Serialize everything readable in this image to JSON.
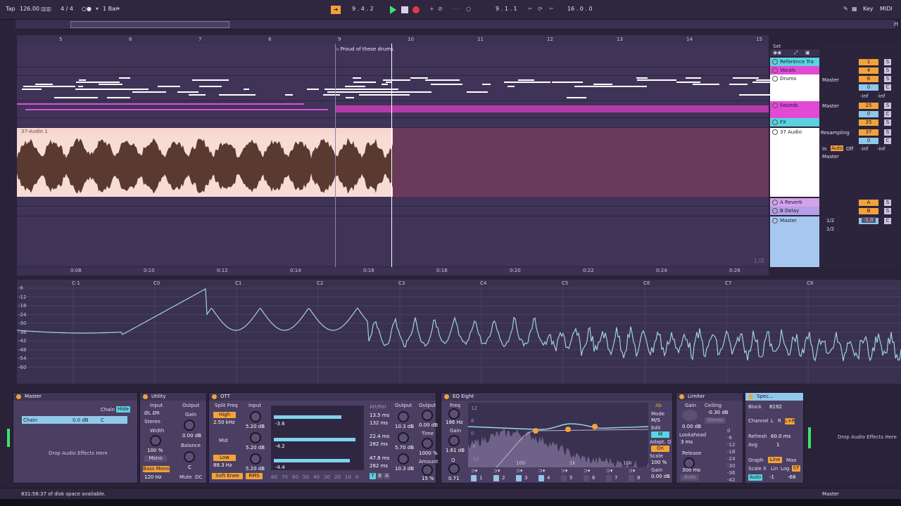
{
  "transport": {
    "tap": "Tap",
    "tempo": "126.00",
    "signature": "4 / 4",
    "metro_dots": "○●",
    "quantize": "1 Bar",
    "position": "9 .  4 .  2",
    "loop_start": "9 .  1 .  1",
    "loop_length": "16 .  0 .  0",
    "key_label": "Key",
    "midi_label": "MIDI",
    "follow_label": "H"
  },
  "ruler": {
    "bars": [
      "5",
      "6",
      "7",
      "8",
      "9",
      "10",
      "11",
      "12",
      "13",
      "14",
      "15"
    ],
    "times": [
      "0:08",
      "0:10",
      "0:12",
      "0:14",
      "0:16",
      "0:18",
      "0:20",
      "0:22",
      "0:24",
      "0:26"
    ],
    "zoom": "1/8"
  },
  "locator": "Proud of these drums",
  "audio_clip": {
    "title": "37-Audio 1"
  },
  "tracks": {
    "set_label": "Set",
    "items": [
      {
        "name": "Reference Tra",
        "color": "#5ad3e0"
      },
      {
        "name": "Vocals",
        "color": "#e24ad6"
      },
      {
        "name": "Drums",
        "color": "#ffffff"
      },
      {
        "name": "Sounds",
        "color": "#e24ad6"
      },
      {
        "name": "FX",
        "color": "#5ad3e0"
      },
      {
        "name": "37 Audio",
        "color": "#ffffff"
      },
      {
        "name": "A Reverb",
        "color": "#d5a3ea"
      },
      {
        "name": "B Delay",
        "color": "#b49fe8"
      },
      {
        "name": "Master",
        "color": "#a6c8f0"
      }
    ]
  },
  "mixer": {
    "route_drums": "Master",
    "route_sounds": "Master",
    "route_audio": "Resampling",
    "route_audio_out": "Master",
    "nums": [
      "1",
      "4",
      "6",
      "0",
      "25",
      "0",
      "35",
      "37",
      "0",
      "A",
      "B",
      "0"
    ],
    "inf": "-inf",
    "in_auto_off": [
      "In",
      "Auto",
      "Off"
    ],
    "sends": [
      "1/2",
      "1/2"
    ],
    "master_vol": "-1.0",
    "s_label": "S",
    "c_label": "C"
  },
  "spectrum": {
    "db": [
      "-6",
      "-12",
      "-18",
      "-24",
      "-30",
      "-36",
      "-42",
      "-48",
      "-54",
      "-60"
    ],
    "notes": [
      "C-1",
      "C0",
      "C1",
      "C2",
      "C3",
      "C4",
      "C5",
      "C6",
      "C7",
      "C8"
    ]
  },
  "devices": {
    "master": {
      "title": "Master",
      "chain_label": "Chain",
      "hide_label": "Hide",
      "chain_name": "Chain",
      "chain_db": "0.0 dB",
      "chain_pan": "C",
      "drop": "Drop Audio Effects Here"
    },
    "utility": {
      "title": "Utility",
      "input": "Input",
      "output": "Output",
      "phase": "ØL  ØR",
      "stereo": "Stereo",
      "gain_label": "Gain",
      "gain": "0.00 dB",
      "width_label": "Width",
      "width": "100 %",
      "balance_label": "Balance",
      "balance": "C",
      "mono": "Mono",
      "bass_mono": "Bass Mono",
      "bass_freq": "120 Hz",
      "mute": "Mute",
      "dc": "DC"
    },
    "ott": {
      "title": "OTT",
      "split_freq": "Split Freq",
      "input": "Input",
      "high": "High",
      "high_freq": "2.50 kHz",
      "mid": "Mid",
      "low": "Low",
      "low_freq": "88.3 Hz",
      "input_vals": [
        "5.20 dB",
        "5.20 dB",
        "5.20 dB"
      ],
      "bar_vals": [
        "-3.6",
        "-4.2",
        "-4.4"
      ],
      "att_rel": "Att/Rel",
      "times": [
        "13.5 ms",
        "132 ms",
        "22.4 ms",
        "282 ms",
        "47.8 ms",
        "282 ms"
      ],
      "output": "Output",
      "output_vals": [
        "10.3 dB",
        "5.70 dB",
        "10.3 dB"
      ],
      "out2": "Output",
      "out2_val": "0.00 dB",
      "time_label": "Time",
      "time_val": "1000 %",
      "amount_label": "Amount",
      "amount_val": "15 %",
      "soft_knee": "Soft Knee",
      "rms": "RMS",
      "scale": [
        "80",
        "70",
        "60",
        "50",
        "40",
        "30",
        "20",
        "10",
        "0"
      ],
      "tba": [
        "T",
        "B",
        "A"
      ]
    },
    "eq": {
      "title": "EQ Eight",
      "freq_label": "Freq",
      "freq": "186 Hz",
      "gain_label": "Gain",
      "gain": "1.61 dB",
      "q_label": "Q",
      "q": "0.71",
      "db_scale": [
        "12",
        "6",
        "0",
        "-6",
        "-12"
      ],
      "freq_scale": [
        "100",
        "1k",
        "10k"
      ],
      "bands": [
        "1",
        "2",
        "3",
        "4",
        "5",
        "6",
        "7",
        "8"
      ],
      "mode_label": "Mode",
      "mode": "M/S",
      "edit_label": "Edit",
      "edit_val": "M",
      "adapt_q": "Adapt. Q",
      "adapt_val": "On",
      "scale_label": "Scale",
      "scale_val": "100 %",
      "out_gain_label": "Gain",
      "out_gain": "0.00 dB",
      "ab": "Ab"
    },
    "limiter": {
      "title": "Limiter",
      "gain_label": "Gain",
      "gain": "0.00 dB",
      "ceiling_label": "Ceiling",
      "ceiling": "-0.30 dB",
      "stereo": "Stereo",
      "lookahead_label": "Lookahead",
      "lookahead": "3 ms",
      "release_label": "Release",
      "release": "300 ms",
      "auto": "Auto",
      "scale": [
        "0",
        "-6",
        "-12",
        "-18",
        "-24",
        "-30",
        "-36",
        "-42"
      ]
    },
    "spectrum": {
      "title": "Spec...",
      "block_label": "Block",
      "block": "8192",
      "channel_label": "Channel",
      "channel_l": "L",
      "channel_r": "R",
      "channel_lr": "L+R",
      "refresh_label": "Refresh",
      "refresh": "60.0 ms",
      "avg_label": "Avg",
      "avg": "1",
      "graph_label": "Graph",
      "graph_line": "Line",
      "graph_max": "Max",
      "scalex_label": "Scale X",
      "scalex": [
        "Lin",
        "Log",
        "ST"
      ],
      "auto": "Auto",
      "range_lo": "-1",
      "range_hi": "-68"
    },
    "drop_right": "Drop Audio Effects Here"
  },
  "status": {
    "disk": "831:58:37 of disk space available.",
    "master": "Master"
  },
  "colors": {
    "accent_orange": "#f3a23a",
    "cyan": "#5ad3e0",
    "magenta": "#e24ad6",
    "clip_peach": "#f7dcd6"
  }
}
